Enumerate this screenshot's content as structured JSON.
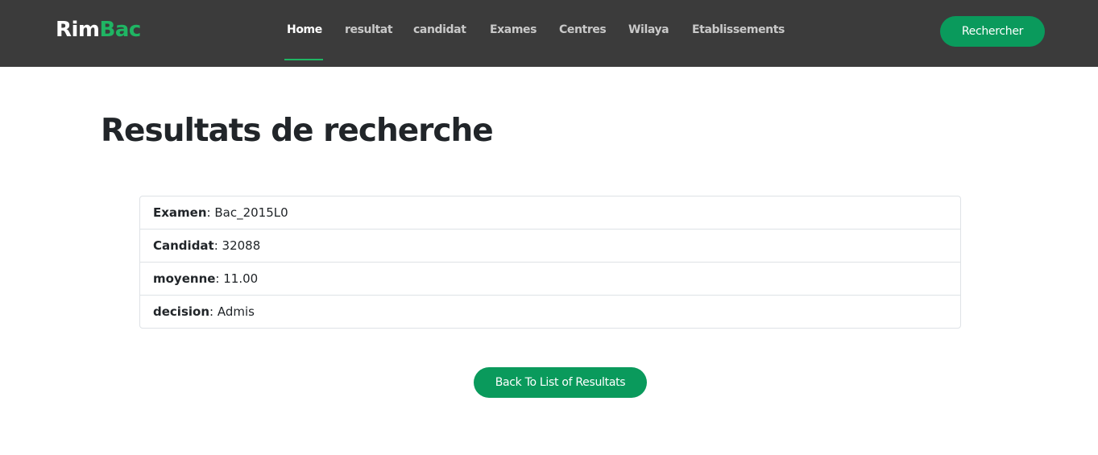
{
  "brand": {
    "part1": "Rim",
    "part2": "Bac",
    "accent_color": "#1fb563"
  },
  "nav": {
    "items": [
      {
        "label": "Home",
        "active": true
      },
      {
        "label": "resultat",
        "active": false
      },
      {
        "label": "candidat",
        "active": false
      },
      {
        "label": "Exames",
        "active": false
      },
      {
        "label": "Centres",
        "active": false
      },
      {
        "label": "Wilaya",
        "active": false
      },
      {
        "label": "Etablissements",
        "active": false
      }
    ],
    "search_label": "Rechercher"
  },
  "main": {
    "title": "Resultats de recherche",
    "results": [
      {
        "label": "Examen",
        "value": ": Bac_2015L0"
      },
      {
        "label": "Candidat",
        "value": ": 32088"
      },
      {
        "label": "moyenne",
        "value": ": 11.00"
      },
      {
        "label": "decision",
        "value": ": Admis"
      }
    ],
    "back_label": "Back To List of Resultats"
  },
  "colors": {
    "navbar": "#3b3b3b",
    "button": "#0a9a5c"
  }
}
